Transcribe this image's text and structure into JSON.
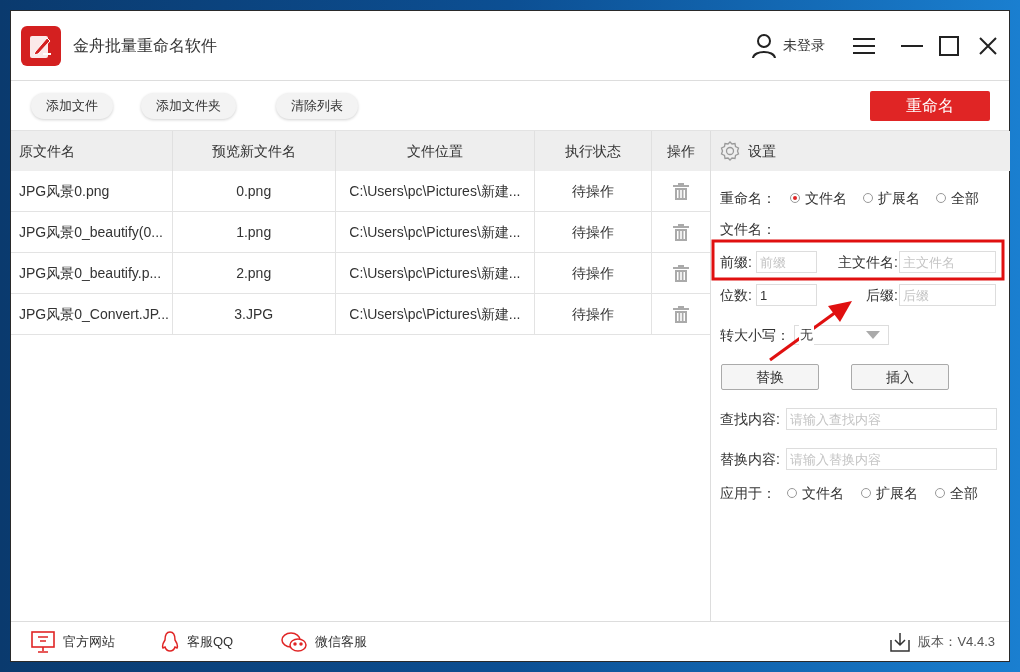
{
  "window": {
    "title": "金舟批量重命名软件",
    "user": "未登录"
  },
  "toolbar": {
    "buttons": [
      "添加文件",
      "添加文件夹",
      "清除列表"
    ],
    "primary": "重命名"
  },
  "table": {
    "columns": [
      "原文件名",
      "预览新文件名",
      "文件位置",
      "执行状态",
      "操作"
    ],
    "rows": [
      {
        "cells": [
          "JPG风景0.png",
          "0.png",
          "C:\\Users\\pc\\Pictures\\新建...",
          "待操作"
        ]
      },
      {
        "cells": [
          "JPG风景0_beautify(0...",
          "1.png",
          "C:\\Users\\pc\\Pictures\\新建...",
          "待操作"
        ]
      },
      {
        "cells": [
          "JPG风景0_beautify.p...",
          "2.png",
          "C:\\Users\\pc\\Pictures\\新建...",
          "待操作"
        ]
      },
      {
        "cells": [
          "JPG风景0_Convert.JP...",
          "3.JPG",
          "C:\\Users\\pc\\Pictures\\新建...",
          "待操作"
        ]
      }
    ]
  },
  "settings": {
    "title": "设置",
    "rename_label": "重命名：",
    "rename_options": [
      {
        "label": "文件名",
        "selected": true
      },
      {
        "label": "扩展名",
        "selected": false
      },
      {
        "label": "全部",
        "selected": false
      }
    ],
    "filename_label": "文件名：",
    "fields": [
      {
        "label": "前缀:",
        "placeholder": "前缀"
      },
      {
        "label": "主文件名:",
        "placeholder": "主文件名"
      },
      {
        "label": "位数:",
        "value": "1"
      },
      {
        "label": "后缀:",
        "placeholder": "后缀"
      }
    ],
    "case_label": "转大小写：",
    "case_value": "无",
    "buttons": [
      "替换",
      "插入"
    ],
    "find": {
      "label": "查找内容:",
      "placeholder": "请输入查找内容"
    },
    "replace": {
      "label": "替换内容:",
      "placeholder": "请输入替换内容"
    },
    "apply_label": "应用于：",
    "apply_options": [
      {
        "label": "文件名",
        "selected": false
      },
      {
        "label": "扩展名",
        "selected": false
      },
      {
        "label": "全部",
        "selected": false
      }
    ]
  },
  "footer": {
    "links": [
      "官方网站",
      "客服QQ",
      "微信客服"
    ],
    "version": "版本：V4.4.3"
  }
}
